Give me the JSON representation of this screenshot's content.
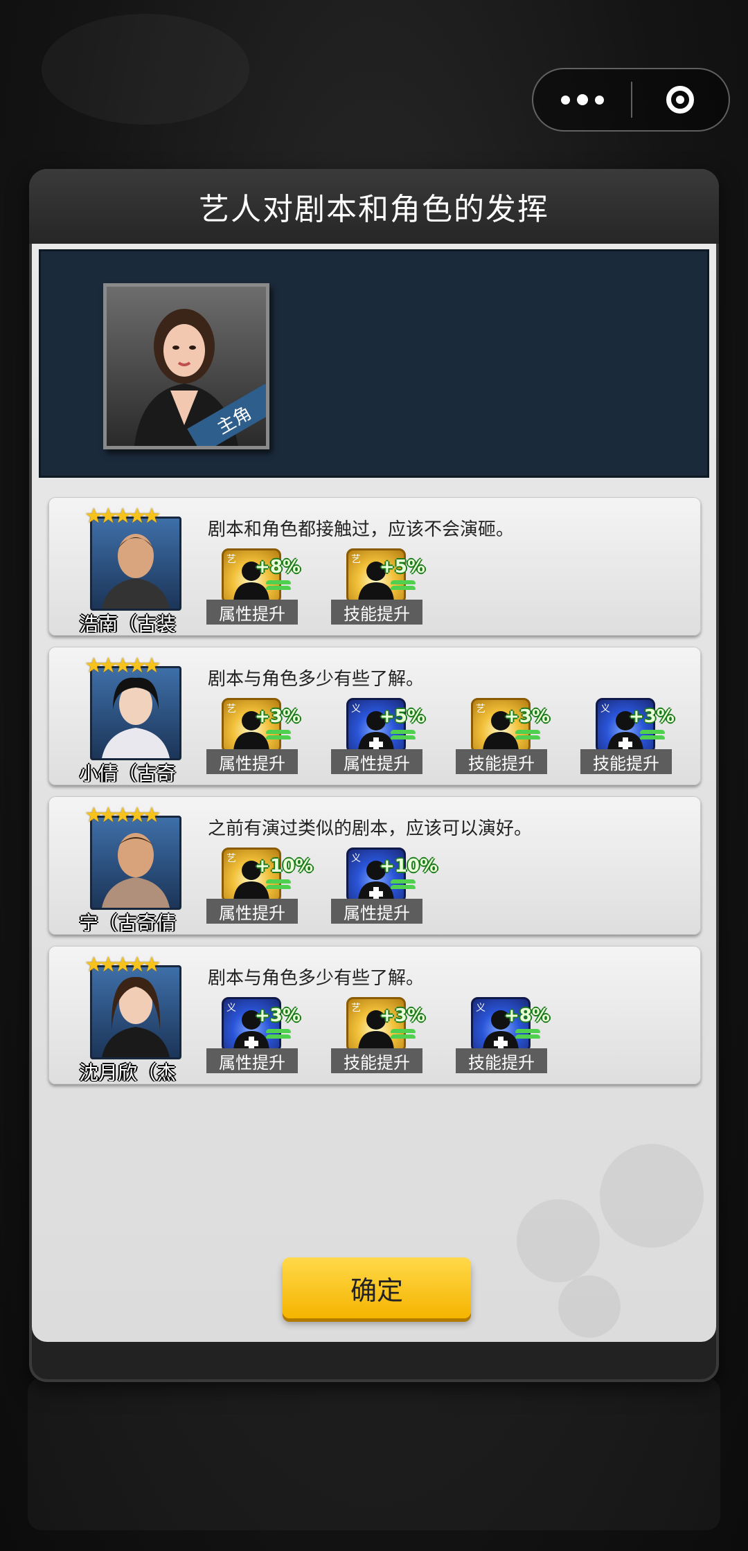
{
  "dialog": {
    "title": "艺人对剧本和角色的发挥"
  },
  "lead": {
    "tag": "主角",
    "icon": "lead-actress-portrait"
  },
  "rows": [
    {
      "name": "浩南（古装",
      "stars": "★★★★★",
      "comment": "剧本和角色都接触过，应该不会演砸。",
      "bonuses": [
        {
          "pct": "+8%",
          "label": "属性提升",
          "color": "gold"
        },
        {
          "pct": "+5%",
          "label": "技能提升",
          "color": "gold"
        }
      ]
    },
    {
      "name": "小倩（古奇",
      "stars": "★★★★★",
      "comment": "剧本与角色多少有些了解。",
      "bonuses": [
        {
          "pct": "+3%",
          "label": "属性提升",
          "color": "gold"
        },
        {
          "pct": "+5%",
          "label": "属性提升",
          "color": "blue"
        },
        {
          "pct": "+3%",
          "label": "技能提升",
          "color": "gold"
        },
        {
          "pct": "+3%",
          "label": "技能提升",
          "color": "blue"
        }
      ]
    },
    {
      "name": "宁（古奇倩",
      "stars": "★★★★★",
      "comment": "之前有演过类似的剧本，应该可以演好。",
      "bonuses": [
        {
          "pct": "+10%",
          "label": "属性提升",
          "color": "gold"
        },
        {
          "pct": "+10%",
          "label": "属性提升",
          "color": "blue"
        }
      ]
    },
    {
      "name": "沈月欣（杰",
      "stars": "★★★★★",
      "comment": "剧本与角色多少有些了解。",
      "bonuses": [
        {
          "pct": "+3%",
          "label": "属性提升",
          "color": "blue"
        },
        {
          "pct": "+3%",
          "label": "技能提升",
          "color": "gold"
        },
        {
          "pct": "+8%",
          "label": "技能提升",
          "color": "blue"
        }
      ]
    }
  ],
  "confirm_label": "确定",
  "colors": {
    "accent": "#f5b400",
    "panel": "#1b2a3b",
    "gain": "#4fd14f"
  }
}
